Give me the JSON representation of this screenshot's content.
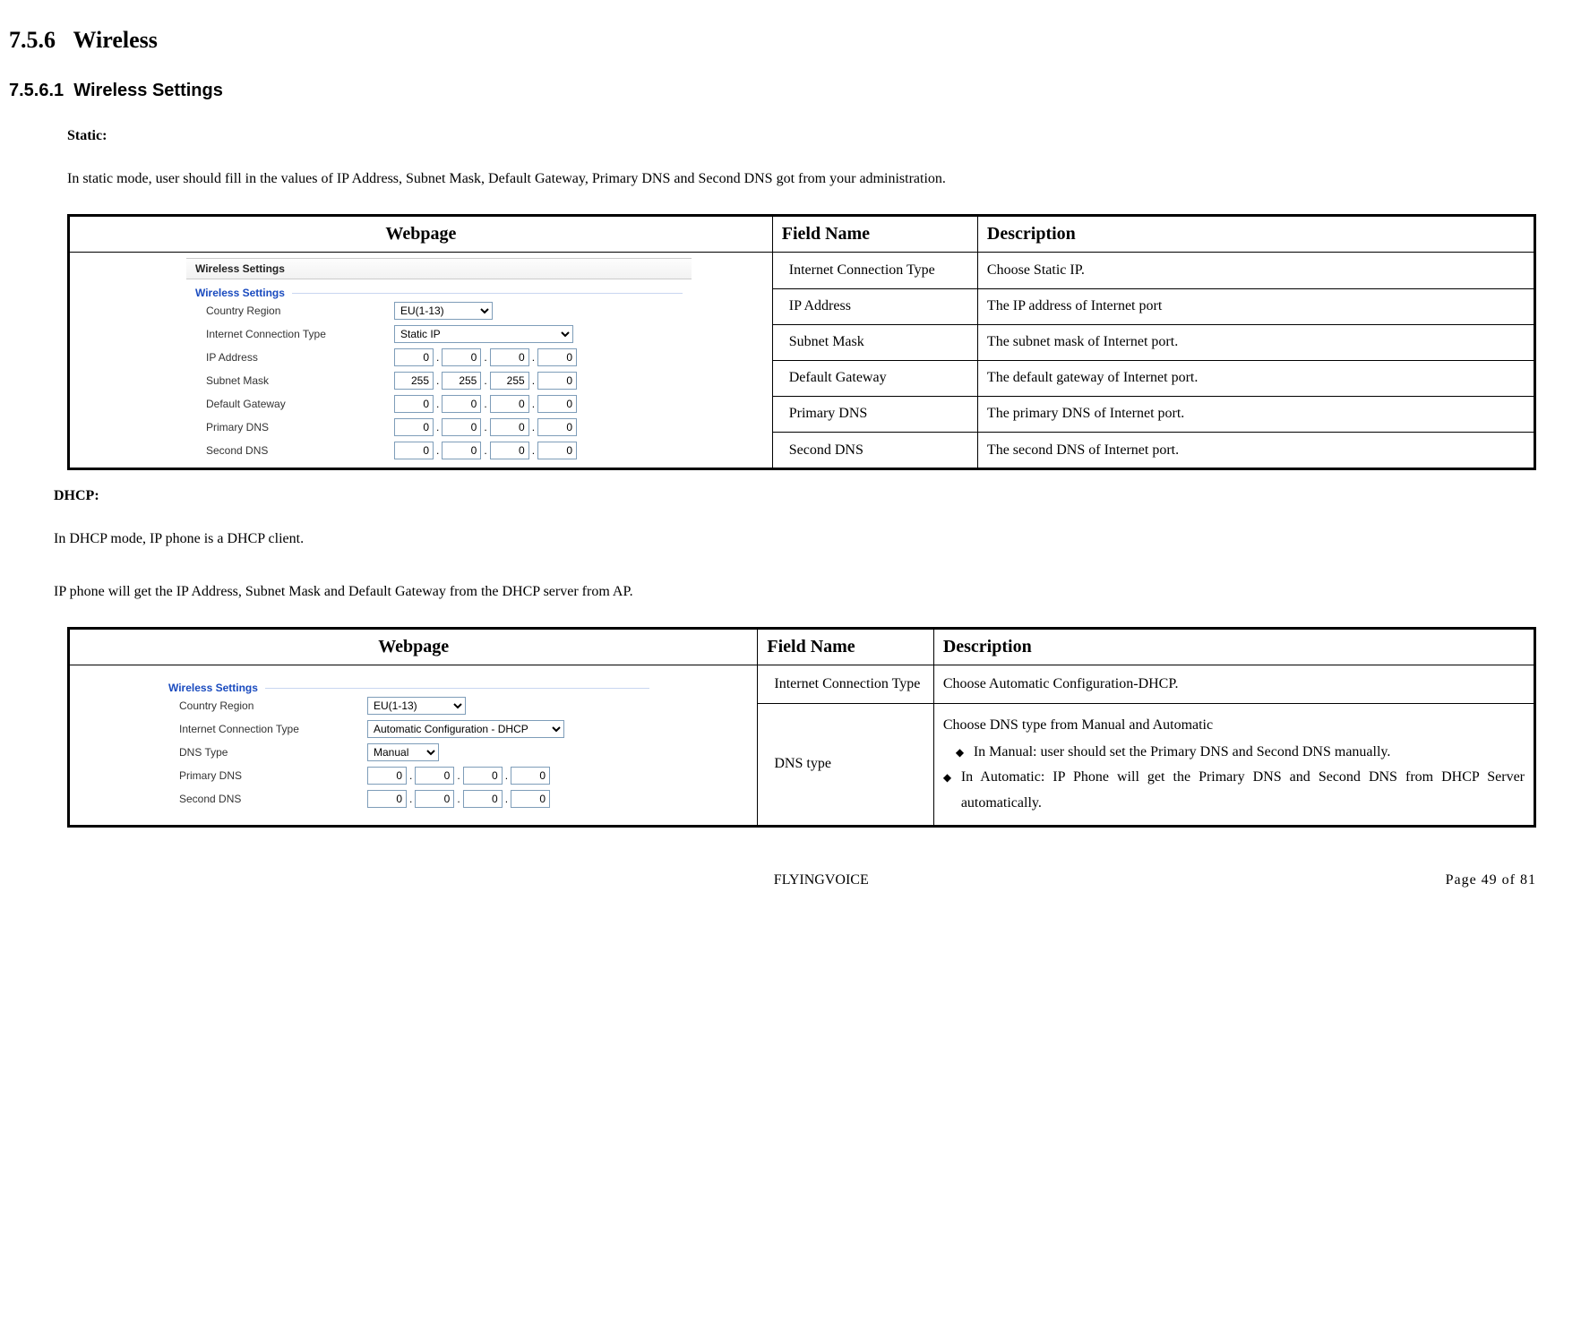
{
  "headings": {
    "h1_num": "7.5.6",
    "h1_text": "Wireless",
    "h2_num": "7.5.6.1",
    "h2_text": "Wireless Settings"
  },
  "static_section": {
    "title": "Static:",
    "desc": "In static mode, user should fill in the values of IP Address, Subnet Mask, Default Gateway, Primary DNS and Second DNS got from your administration."
  },
  "table_headers": {
    "webpage": "Webpage",
    "field_name": "Field Name",
    "description": "Description"
  },
  "webpage_static": {
    "panel_title": "Wireless Settings",
    "group_title": "Wireless Settings",
    "rows": {
      "country_region": {
        "label": "Country Region",
        "value": "EU(1-13)"
      },
      "ict": {
        "label": "Internet Connection Type",
        "value": "Static IP"
      },
      "ip_address": {
        "label": "IP Address",
        "o1": "0",
        "o2": "0",
        "o3": "0",
        "o4": "0"
      },
      "subnet_mask": {
        "label": "Subnet Mask",
        "o1": "255",
        "o2": "255",
        "o3": "255",
        "o4": "0"
      },
      "default_gateway": {
        "label": "Default Gateway",
        "o1": "0",
        "o2": "0",
        "o3": "0",
        "o4": "0"
      },
      "primary_dns": {
        "label": "Primary DNS",
        "o1": "0",
        "o2": "0",
        "o3": "0",
        "o4": "0"
      },
      "second_dns": {
        "label": "Second DNS",
        "o1": "0",
        "o2": "0",
        "o3": "0",
        "o4": "0"
      }
    }
  },
  "static_rows": [
    {
      "field": "Internet Connection Type",
      "desc": "Choose Static IP."
    },
    {
      "field": "IP Address",
      "desc": "The IP address of Internet port"
    },
    {
      "field": "Subnet Mask",
      "desc": "The subnet mask of Internet port."
    },
    {
      "field": "Default Gateway",
      "desc": "The default gateway of Internet port."
    },
    {
      "field": "Primary DNS",
      "desc": "The primary DNS of Internet port."
    },
    {
      "field": "Second DNS",
      "desc": "The second DNS of Internet port."
    }
  ],
  "dhcp_section": {
    "title": "DHCP:",
    "desc1": "In DHCP mode, IP phone is a DHCP client.",
    "desc2": "IP phone will get the IP Address, Subnet Mask and Default Gateway from the DHCP server from AP."
  },
  "webpage_dhcp": {
    "group_title": "Wireless Settings",
    "rows": {
      "country_region": {
        "label": "Country Region",
        "value": "EU(1-13)"
      },
      "ict": {
        "label": "Internet Connection Type",
        "value": "Automatic Configuration - DHCP"
      },
      "dns_type": {
        "label": "DNS Type",
        "value": "Manual"
      },
      "primary_dns": {
        "label": "Primary DNS",
        "o1": "0",
        "o2": "0",
        "o3": "0",
        "o4": "0"
      },
      "second_dns": {
        "label": "Second DNS",
        "o1": "0",
        "o2": "0",
        "o3": "0",
        "o4": "0"
      }
    }
  },
  "dhcp_rows": {
    "ict": {
      "field": "Internet Connection Type",
      "desc": "Choose Automatic Configuration-DHCP."
    },
    "dns": {
      "field": "DNS type",
      "intro": "Choose DNS type from Manual and Automatic",
      "b1": "In Manual: user should set the Primary DNS and Second DNS manually.",
      "b2": "In Automatic: IP Phone will get the Primary DNS and Second DNS from DHCP Server automatically."
    }
  },
  "footer": {
    "center": "FLYINGVOICE",
    "right": "Page 49 of 81"
  }
}
